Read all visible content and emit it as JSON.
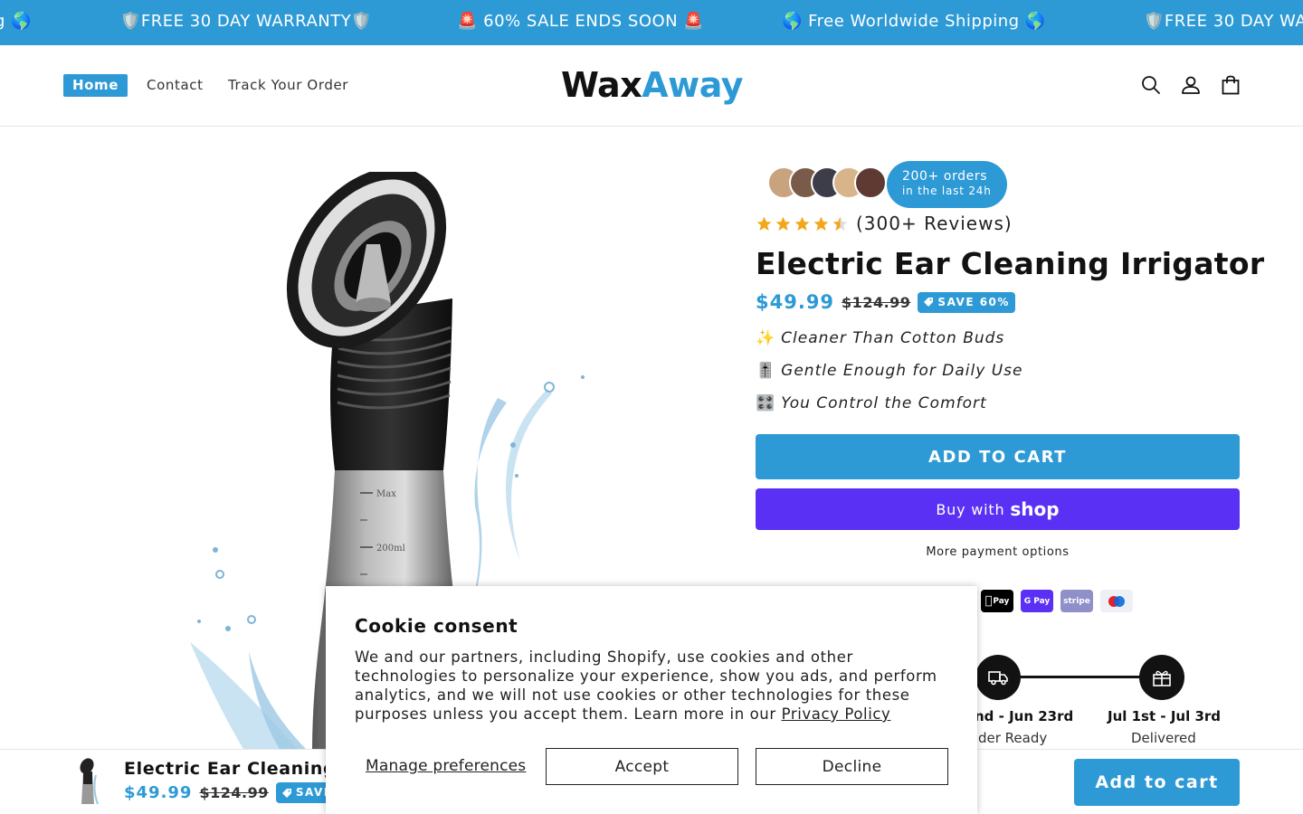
{
  "announcement": {
    "items": [
      "g 🌎",
      "🛡️FREE 30 DAY WARRANTY🛡️",
      "🚨 60% SALE ENDS SOON 🚨",
      "🌎 Free Worldwide Shipping 🌎",
      "🛡️FREE 30 DAY WA"
    ],
    "color": "#2d9ad6"
  },
  "header": {
    "nav": [
      "Home",
      "Contact",
      "Track Your Order"
    ],
    "logo_part1": "Wax",
    "logo_part2": "Away",
    "icons": [
      "search-icon",
      "account-icon",
      "cart-icon"
    ]
  },
  "social_proof": {
    "orders_line1": "200+ orders",
    "orders_line2": "in the last 24h"
  },
  "product": {
    "rating_stars": 4.5,
    "reviews_text": "(300+ Reviews)",
    "title": "Electric Ear Cleaning Irrigator",
    "price": "$49.99",
    "compare_price": "$124.99",
    "save_badge": "SAVE 60%",
    "features": [
      {
        "emoji": "✨",
        "text": "Cleaner Than Cotton Buds"
      },
      {
        "emoji": "🎚️",
        "text": "Gentle Enough for Daily Use"
      },
      {
        "emoji": "🎛️",
        "text": "You Control the Comfort"
      }
    ],
    "add_to_cart": "ADD TO CART",
    "buy_with": "Buy with",
    "shop_logo": "shop",
    "more_payment": "More payment options",
    "payment_icons": [
      "apple-pay-icon",
      "google-pay-icon",
      "stripe-icon",
      "maestro-icon"
    ],
    "payment_labels": [
      "Pay",
      "G Pay",
      "stripe",
      ""
    ]
  },
  "timeline": [
    {
      "date": "nd - Jun 23rd",
      "label": "der Ready",
      "icon": "truck-icon"
    },
    {
      "date": "Jul 1st - Jul 3rd",
      "label": "Delivered",
      "icon": "gift-icon"
    }
  ],
  "sticky": {
    "title": "Electric Ear Cleaning",
    "price": "$49.99",
    "compare_price": "$124.99",
    "save_badge": "SAVE",
    "button": "Add to cart"
  },
  "cookie": {
    "title": "Cookie consent",
    "text": "We and our partners, including Shopify, use cookies and other technologies to personalize your experience, show you ads, and perform analytics, and we will not use cookies or other technologies for these purposes unless you accept them. Learn more in our ",
    "link": "Privacy Policy",
    "manage": "Manage preferences",
    "accept": "Accept",
    "decline": "Decline"
  }
}
